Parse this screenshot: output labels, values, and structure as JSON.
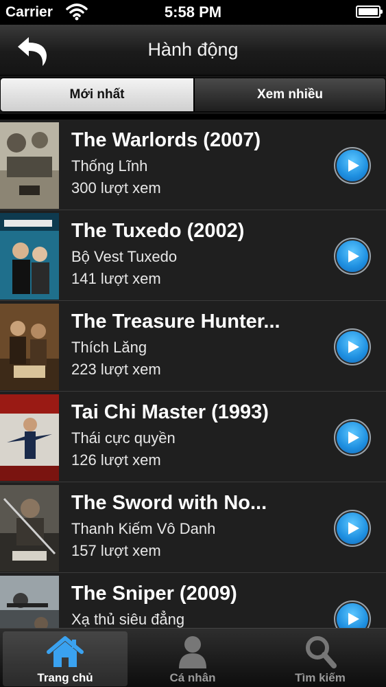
{
  "status_bar": {
    "carrier": "Carrier",
    "time": "5:58 PM"
  },
  "nav": {
    "title": "Hành động",
    "back_icon": "back-arrow-icon"
  },
  "segments": {
    "latest": "Mới nhất",
    "popular": "Xem nhiều",
    "selected": "latest"
  },
  "movies": [
    {
      "title": "The Warlords (2007)",
      "subtitle": "Thống Lĩnh",
      "views": "300 lượt xem"
    },
    {
      "title": "The Tuxedo (2002)",
      "subtitle": "Bộ Vest Tuxedo",
      "views": "141 lượt xem"
    },
    {
      "title": "The Treasure Hunter...",
      "subtitle": "Thích Lăng",
      "views": "223 lượt xem"
    },
    {
      "title": "Tai Chi Master (1993)",
      "subtitle": "Thái cực quyền",
      "views": "126 lượt xem"
    },
    {
      "title": "The Sword with No...",
      "subtitle": "Thanh Kiếm Vô Danh",
      "views": "157 lượt xem"
    },
    {
      "title": "The Sniper (2009)",
      "subtitle": "Xạ thủ siêu đẳng",
      "views": ""
    }
  ],
  "tabs": [
    {
      "label": "Trang chủ",
      "icon": "home-icon",
      "selected": true
    },
    {
      "label": "Cá nhân",
      "icon": "person-icon",
      "selected": false
    },
    {
      "label": "Tìm kiếm",
      "icon": "search-icon",
      "selected": false
    }
  ],
  "colors": {
    "accent_blue": "#1e8fe0",
    "background": "#1f1f1f",
    "home_icon": "#3aa2f0"
  }
}
